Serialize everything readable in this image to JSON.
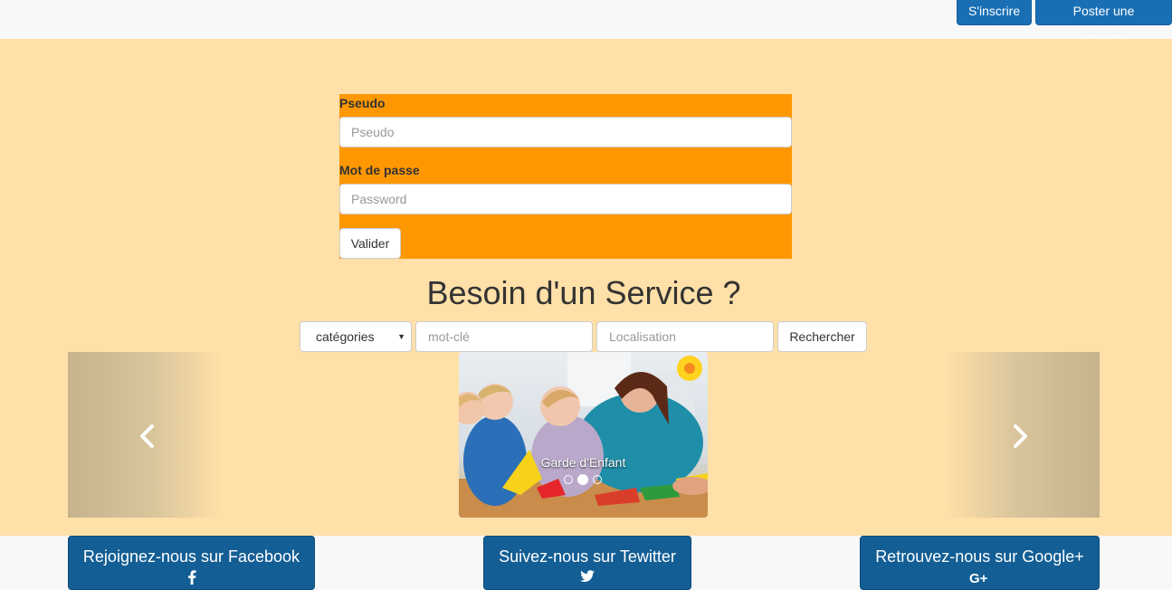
{
  "header": {
    "register_label": "S'inscrire",
    "post_label": "Poster une annonce"
  },
  "login": {
    "user_label": "Pseudo",
    "user_placeholder": "Pseudo",
    "pass_label": "Mot de passe",
    "pass_placeholder": "Password",
    "submit_label": "Valider"
  },
  "search": {
    "headline": "Besoin d'un Service ?",
    "category_selected": "catégories",
    "keyword_placeholder": "mot-clé",
    "location_placeholder": "Localisation",
    "submit_label": "Rechercher"
  },
  "carousel": {
    "caption": "Garde d'Enfant",
    "slide_count": 3,
    "active_index": 1,
    "prev_icon": "chevron-left-icon",
    "next_icon": "chevron-right-icon"
  },
  "social": {
    "facebook_label": "Rejoignez-nous sur Facebook",
    "twitter_label": "Suivez-nous sur Tewitter",
    "google_label": "Retrouvez-nous sur Google+",
    "google_icon_text": "G+"
  },
  "colors": {
    "brand_blue": "#1a6fb4",
    "login_orange": "#ff9800",
    "page_bg": "#ffe0a8"
  }
}
